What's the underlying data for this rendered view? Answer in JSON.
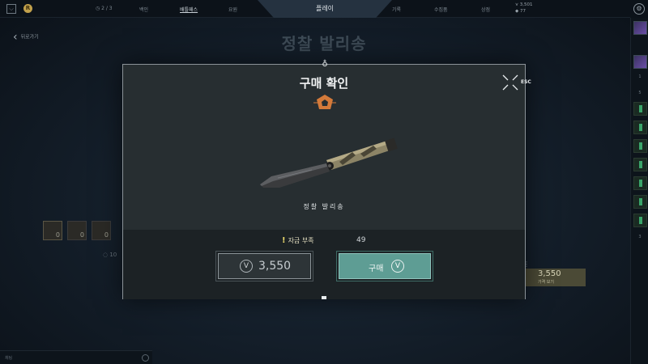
{
  "topbar": {
    "menu_icon": "chevron-down-icon",
    "coin_icon": "radianite-icon",
    "missions_count": "2 / 3",
    "nav": [
      "백인",
      "배틀패스",
      "요원"
    ],
    "play_label": "플레이",
    "right_nav": [
      "기록",
      "수집품",
      "상점"
    ],
    "vp_amount": "3,501",
    "rp_amount": "77",
    "settings_icon": "gear-icon"
  },
  "page": {
    "back_label": "뒤로가기",
    "title": "정찰 발리송",
    "bg_thumb_counts": [
      "0",
      "0",
      "0"
    ],
    "bg_price_value": "3,550",
    "bg_price_sub": "가격 보기",
    "bg_level_value": "10",
    "chat_placeholder": "채팅"
  },
  "right_rail": {
    "numbers": [
      "1",
      "5",
      "5",
      "3"
    ]
  },
  "modal": {
    "title": "구매 확인",
    "esc_label": "ESC",
    "item_name": "정찰 발리송",
    "insufficient_label": "자금 부족",
    "shortfall_amount": "49",
    "price_value": "3,550",
    "buy_label": "구매",
    "currency_icon": "valorant-points-icon",
    "tier_icon": "deluxe-edition-tier-icon",
    "tier_color": "#d47a3a",
    "accent_color": "#5e9d94"
  }
}
